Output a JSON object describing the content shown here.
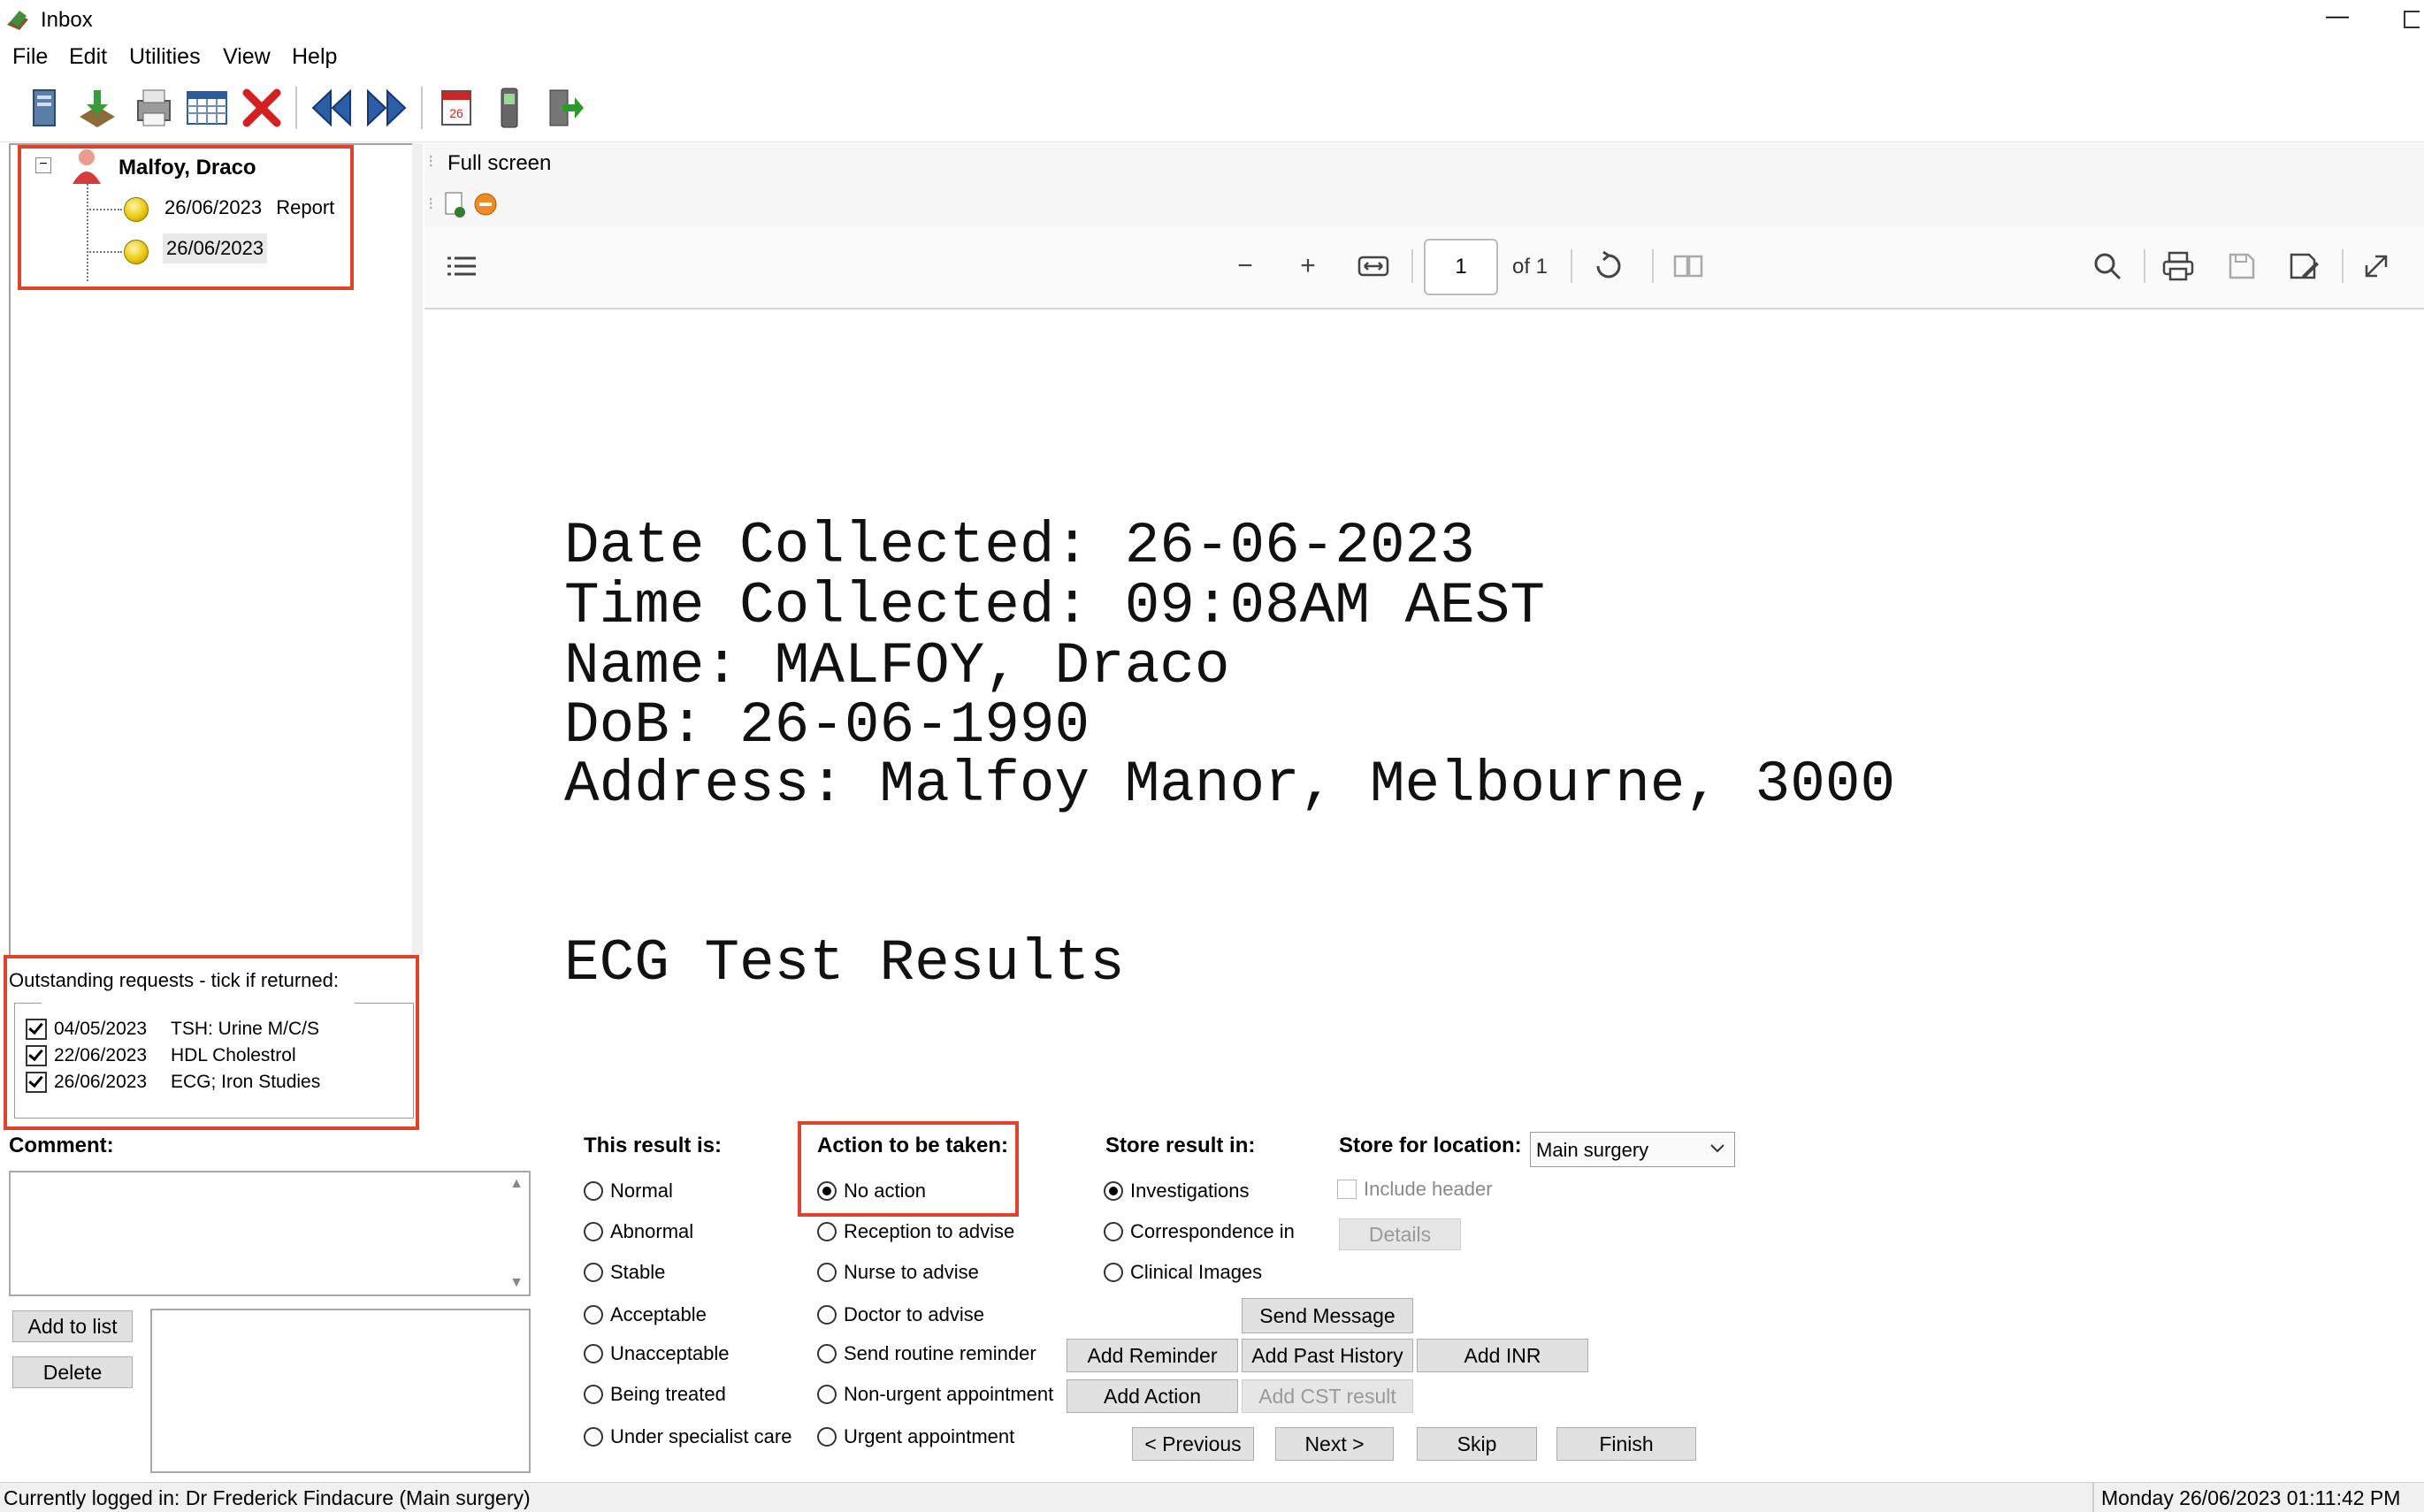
{
  "window": {
    "title": "Inbox",
    "minimize_glyph": "—"
  },
  "menu": [
    "File",
    "Edit",
    "Utilities",
    "View",
    "Help"
  ],
  "toolbar_icons": [
    "server-icon",
    "import-icon",
    "print-icon",
    "grid-icon",
    "delete-icon",
    "previous-icon",
    "next-icon",
    "calendar-icon",
    "phone-icon",
    "exit-icon"
  ],
  "tree": {
    "patient": "Malfoy, Draco",
    "items": [
      {
        "date": "26/06/2023",
        "label": "Report"
      },
      {
        "date": "26/06/2023",
        "label": ""
      }
    ]
  },
  "requests": {
    "header": "Outstanding requests - tick if returned:",
    "rows": [
      {
        "date": "04/05/2023",
        "test": "TSH: Urine M/C/S",
        "checked": true
      },
      {
        "date": "22/06/2023",
        "test": "HDL Cholestrol",
        "checked": true
      },
      {
        "date": "26/06/2023",
        "test": "ECG; Iron Studies",
        "checked": true
      }
    ]
  },
  "comment": {
    "label": "Comment:",
    "add_btn": "Add to list",
    "delete_btn": "Delete"
  },
  "viewer": {
    "full_screen": "Full screen",
    "page_number": "1",
    "page_of": "of 1",
    "document_lines": [
      "Date Collected: 26-06-2023",
      "Time Collected: 09:08AM AEST",
      "Name: MALFOY, Draco",
      "DoB: 26-06-1990",
      "Address: Malfoy Manor, Melbourne, 3000"
    ],
    "document_heading": "ECG Test Results"
  },
  "result_is": {
    "label": "This result is:",
    "options": [
      "Normal",
      "Abnormal",
      "Stable",
      "Acceptable",
      "Unacceptable",
      "Being treated",
      "Under specialist care"
    ]
  },
  "action": {
    "label": "Action to be taken:",
    "selected": "No action",
    "options": [
      "No action",
      "Reception to advise",
      "Nurse to advise",
      "Doctor to advise",
      "Send routine reminder",
      "Non-urgent appointment",
      "Urgent appointment"
    ]
  },
  "store": {
    "label": "Store result in:",
    "selected": "Investigations",
    "options": [
      "Investigations",
      "Correspondence in",
      "Clinical Images"
    ]
  },
  "location": {
    "label": "Store for location:",
    "value": "Main surgery",
    "include_header": "Include header",
    "details_btn": "Details"
  },
  "buttons": {
    "send_message": "Send Message",
    "add_reminder": "Add Reminder",
    "add_past_history": "Add Past History",
    "add_inr": "Add INR",
    "add_action": "Add Action",
    "add_cst": "Add CST result",
    "previous": "< Previous",
    "next": "Next >",
    "skip": "Skip",
    "finish": "Finish"
  },
  "status": {
    "logged_in": "Currently logged in:  Dr Frederick Findacure (Main surgery)",
    "datetime": "Monday 26/06/2023 01:11:42 PM"
  },
  "colors": {
    "highlight_box": "#e0432b"
  }
}
